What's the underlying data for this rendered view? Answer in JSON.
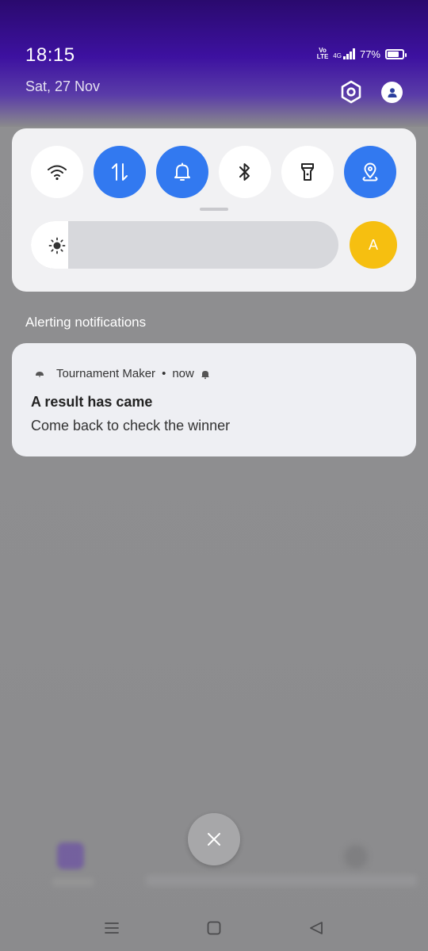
{
  "status_bar": {
    "time": "18:15",
    "date": "Sat, 27 Nov",
    "volte_line1": "Vo",
    "volte_line2": "LTE",
    "network": "4G",
    "battery": "77%",
    "battery_level": 0.77
  },
  "quick_settings": {
    "tiles": [
      {
        "id": "wifi",
        "icon": "wifi-icon",
        "active": false
      },
      {
        "id": "mobile-data",
        "icon": "data-arrows-icon",
        "active": true
      },
      {
        "id": "sound",
        "icon": "bell-icon",
        "active": true
      },
      {
        "id": "bluetooth",
        "icon": "bluetooth-icon",
        "active": false
      },
      {
        "id": "flashlight",
        "icon": "flashlight-icon",
        "active": false
      },
      {
        "id": "location",
        "icon": "location-pin-icon",
        "active": true
      }
    ],
    "brightness_level": 0.12,
    "auto_brightness_label": "A",
    "colors": {
      "active": "#3279f0",
      "auto": "#f6bf10"
    }
  },
  "notifications": {
    "section_label": "Alerting notifications",
    "items": [
      {
        "app_name": "Tournament Maker",
        "separator": "•",
        "time": "now",
        "title": "A result has came",
        "body": "Come back to check the winner"
      }
    ]
  },
  "navigation": {
    "items": [
      "menu-icon",
      "home-icon",
      "back-icon"
    ]
  }
}
